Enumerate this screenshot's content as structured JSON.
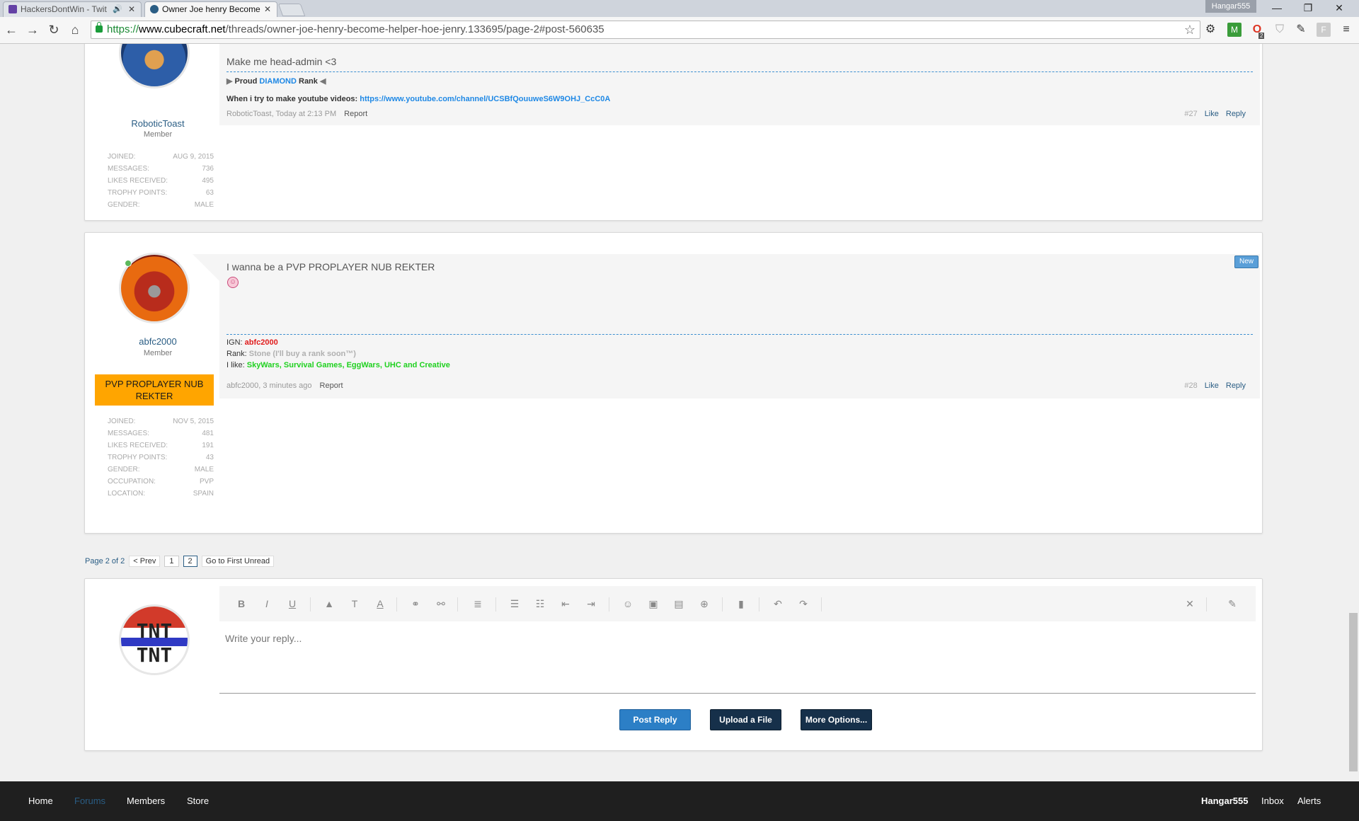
{
  "browser": {
    "tabs": [
      {
        "title": "HackersDontWin - Twit"
      },
      {
        "title": "Owner Joe henry Become"
      }
    ],
    "profile_name": "Hangar555",
    "url_scheme": "https://",
    "url_domain": "www.cubecraft.net",
    "url_path": "/threads/owner-joe-henry-become-helper-hoe-jenry.133695/page-2#post-560635",
    "ext_badge": "2"
  },
  "post27": {
    "username": "RoboticToast",
    "user_title": "Member",
    "message": "Make me head-admin <3",
    "sig_prefix": "Proud ",
    "sig_rank": "DIAMOND",
    "sig_suffix": " Rank",
    "sig_line2_label": "When i try to make youtube videos: ",
    "sig_line2_link": "https://www.youtube.com/channel/UCSBfQouuweS6W9OHJ_CcC0A",
    "meta_author_time": "RoboticToast, Today at 2:13 PM",
    "report": "Report",
    "post_number": "#27",
    "like": "Like",
    "reply": "Reply",
    "stats": [
      {
        "label": "Joined:",
        "value": "Aug 9, 2015"
      },
      {
        "label": "Messages:",
        "value": "736"
      },
      {
        "label": "Likes Received:",
        "value": "495"
      },
      {
        "label": "Trophy Points:",
        "value": "63"
      },
      {
        "label": "Gender:",
        "value": "Male"
      }
    ]
  },
  "post28": {
    "username": "abfc2000",
    "user_title": "Member",
    "banner": "PVP PROPLAYER NUB REKTER",
    "message": "I wanna be a PVP PROPLAYER NUB REKTER",
    "new_badge": "New",
    "sig_ign_label": "IGN: ",
    "sig_ign_value": "abfc2000",
    "sig_rank_label": "Rank: ",
    "sig_rank_value": "Stone (I'll buy a rank soon™)",
    "sig_like_label": "I like: ",
    "sig_like_value": "SkyWars, Survival Games, EggWars, UHC and Creative",
    "meta_author_time": "abfc2000, 3 minutes ago",
    "report": "Report",
    "post_number": "#28",
    "like": "Like",
    "reply": "Reply",
    "stats": [
      {
        "label": "Joined:",
        "value": "Nov 5, 2015"
      },
      {
        "label": "Messages:",
        "value": "481"
      },
      {
        "label": "Likes Received:",
        "value": "191"
      },
      {
        "label": "Trophy Points:",
        "value": "43"
      },
      {
        "label": "Gender:",
        "value": "Male"
      },
      {
        "label": "Occupation:",
        "value": "PVP"
      },
      {
        "label": "Location:",
        "value": "Spain"
      }
    ]
  },
  "pager": {
    "label": "Page 2 of 2",
    "prev": "< Prev",
    "pages": [
      "1",
      "2"
    ],
    "first_unread": "Go to First Unread"
  },
  "reply": {
    "placeholder": "Write your reply...",
    "post_reply": "Post Reply",
    "upload": "Upload a File",
    "more": "More Options..."
  },
  "footer": {
    "home": "Home",
    "forums": "Forums",
    "members": "Members",
    "store": "Store",
    "user": "Hangar555",
    "inbox": "Inbox",
    "alerts": "Alerts"
  },
  "colors": {
    "accent": "#2a5d84",
    "banner": "#ffa500",
    "button_primary": "#2c7fc6",
    "button_dark": "#16304a",
    "ign_red": "#e01b1b",
    "likes_green": "#1fd11f",
    "rank_grey": "#b0b0b0",
    "diamond_blue": "#1e88e5"
  }
}
